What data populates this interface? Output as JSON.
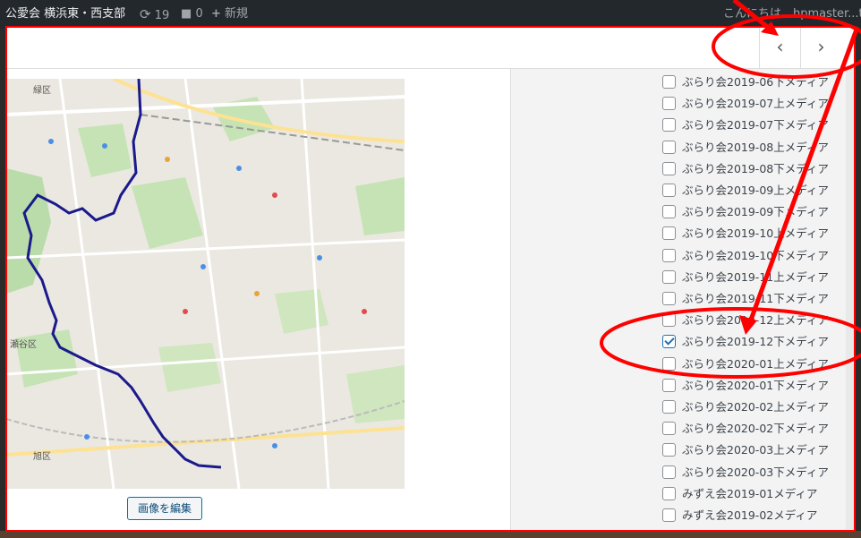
{
  "adminbar": {
    "site_name": "公愛会 横浜東・西支部",
    "updates_icon": "refresh-icon",
    "updates_count": "19",
    "comments_icon": "comment-bubble-icon",
    "comments_count": "0",
    "new_icon": "plus-icon",
    "new_label": "新規",
    "greeting_partial": "こんにちは、",
    "user_partial": "hpmaster...tsu"
  },
  "toolbar": {
    "prev_label": "‹",
    "next_label": "›"
  },
  "attachment": {
    "image_alt": "walking route map (Yokohama)",
    "edit_button_label": "画像を編集",
    "map_labels": [
      "緑区",
      "瀬谷区",
      "旭区"
    ]
  },
  "categories": {
    "items": [
      {
        "label": "ぶらり会2019-06下メディア",
        "checked": false
      },
      {
        "label": "ぶらり会2019-07上メディア",
        "checked": false
      },
      {
        "label": "ぶらり会2019-07下メディア",
        "checked": false
      },
      {
        "label": "ぶらり会2019-08上メディア",
        "checked": false
      },
      {
        "label": "ぶらり会2019-08下メディア",
        "checked": false
      },
      {
        "label": "ぶらり会2019-09上メディア",
        "checked": false
      },
      {
        "label": "ぶらり会2019-09下メディア",
        "checked": false
      },
      {
        "label": "ぶらり会2019-10上メディア",
        "checked": false
      },
      {
        "label": "ぶらり会2019-10下メディア",
        "checked": false
      },
      {
        "label": "ぶらり会2019-11上メディア",
        "checked": false
      },
      {
        "label": "ぶらり会2019-11下メディア",
        "checked": false
      },
      {
        "label": "ぶらり会2019-12上メディア",
        "checked": false
      },
      {
        "label": "ぶらり会2019-12下メディア",
        "checked": true
      },
      {
        "label": "ぶらり会2020-01上メディア",
        "checked": false
      },
      {
        "label": "ぶらり会2020-01下メディア",
        "checked": false
      },
      {
        "label": "ぶらり会2020-02上メディア",
        "checked": false
      },
      {
        "label": "ぶらり会2020-02下メディア",
        "checked": false
      },
      {
        "label": "ぶらり会2020-03上メディア",
        "checked": false
      },
      {
        "label": "ぶらり会2020-03下メディア",
        "checked": false
      },
      {
        "label": "みずえ会2019-01メディア",
        "checked": false
      },
      {
        "label": "みずえ会2019-02メディア",
        "checked": false
      }
    ]
  },
  "annotation_colors": {
    "red": "#ff0000",
    "check_blue": "#2271b1",
    "route_blue": "#1a1a8c",
    "adminbar_bg": "#23282d"
  }
}
